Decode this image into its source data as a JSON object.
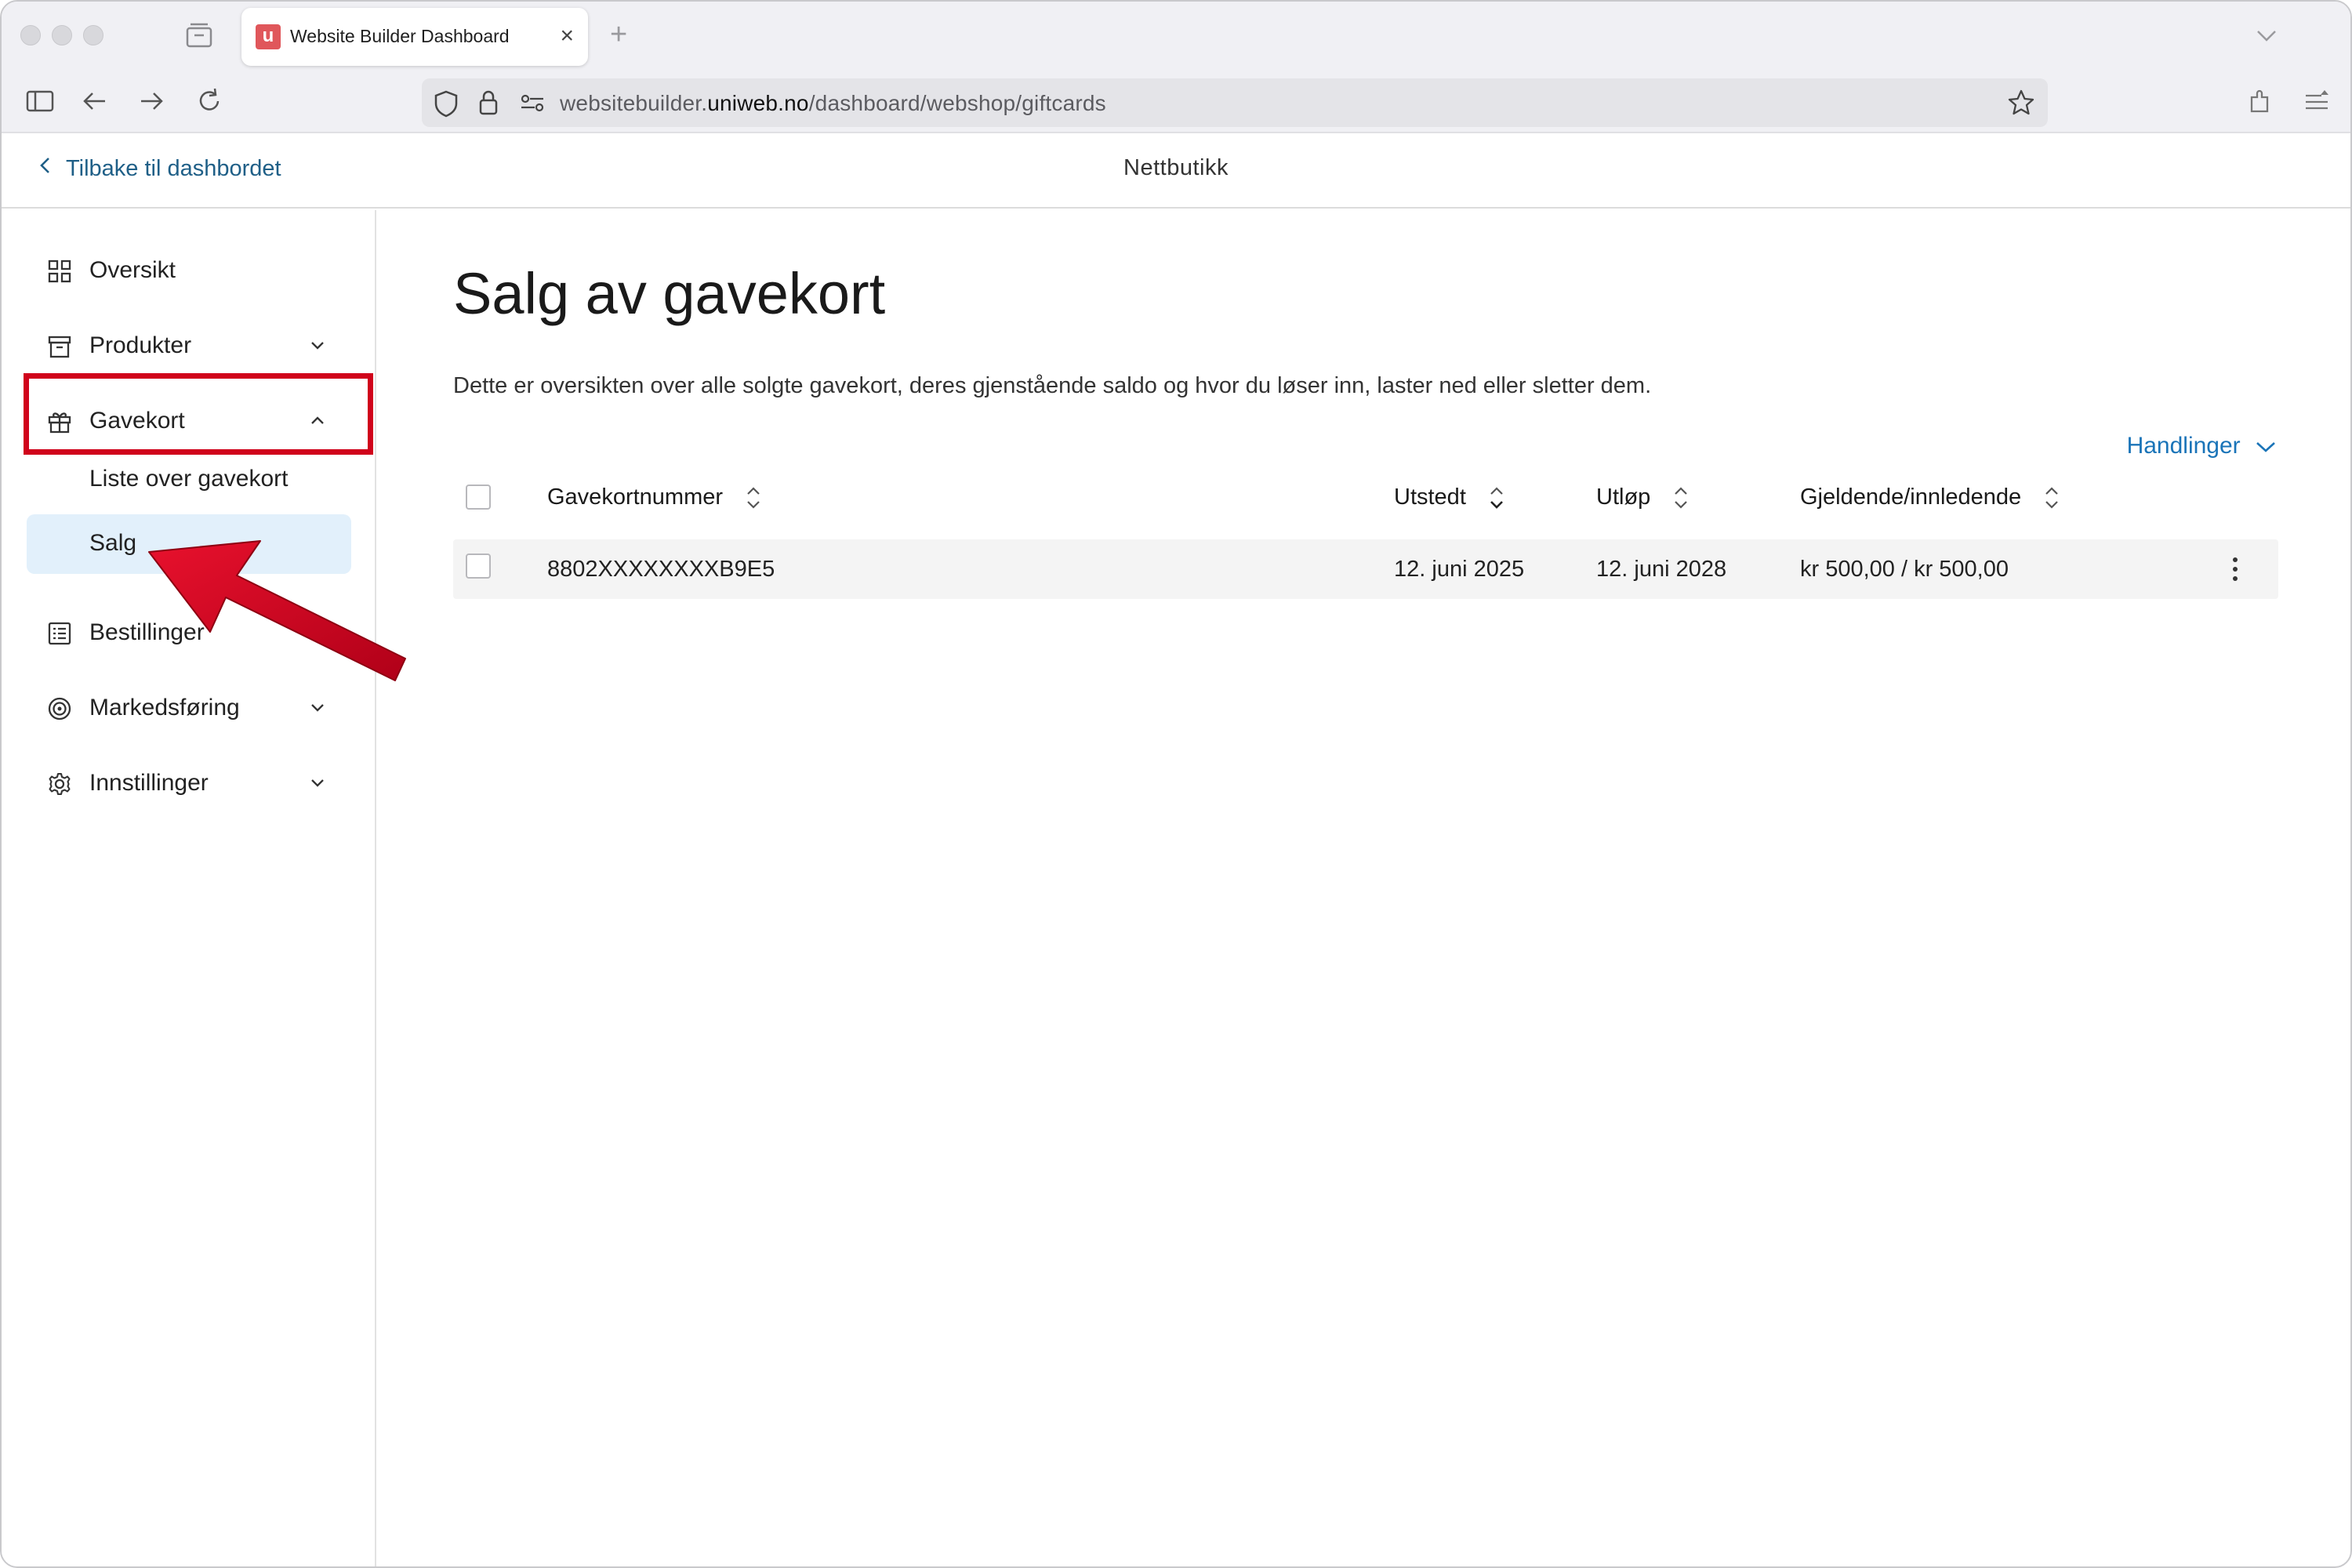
{
  "browser": {
    "tab_title": "Website Builder Dashboard",
    "favicon_letter": "u",
    "url_prefix": "websitebuilder.",
    "url_domain": "uniweb.no",
    "url_path": "/dashboard/webshop/giftcards"
  },
  "header": {
    "back_label": "Tilbake til dashbordet",
    "title": "Nettbutikk"
  },
  "sidebar": {
    "items": [
      {
        "label": "Oversikt",
        "icon": "grid-icon"
      },
      {
        "label": "Produkter",
        "icon": "archive-box-icon"
      },
      {
        "label": "Gavekort",
        "icon": "gift-icon"
      },
      {
        "label": "Bestillinger",
        "icon": "list-icon"
      },
      {
        "label": "Markedsføring",
        "icon": "target-icon"
      },
      {
        "label": "Innstillinger",
        "icon": "gear-icon"
      }
    ],
    "gavekort_sub": [
      {
        "label": "Liste over gavekort"
      },
      {
        "label": "Salg"
      }
    ]
  },
  "main": {
    "title": "Salg av gavekort",
    "description": "Dette er oversikten over alle solgte gavekort, deres gjenstående saldo og hvor du løser inn, laster ned eller sletter dem.",
    "actions_label": "Handlinger",
    "table": {
      "columns": [
        "Gavekortnummer",
        "Utstedt",
        "Utløp",
        "Gjeldende/innledende"
      ],
      "rows": [
        {
          "number": "8802XXXXXXXXB9E5",
          "issued": "12. juni 2025",
          "expires": "12. juni 2028",
          "balance": "kr 500,00 / kr 500,00"
        }
      ]
    }
  },
  "colors": {
    "accent": "#1a74b8",
    "active_bg": "#e2f0fb",
    "annotation_red": "#d0021b"
  }
}
